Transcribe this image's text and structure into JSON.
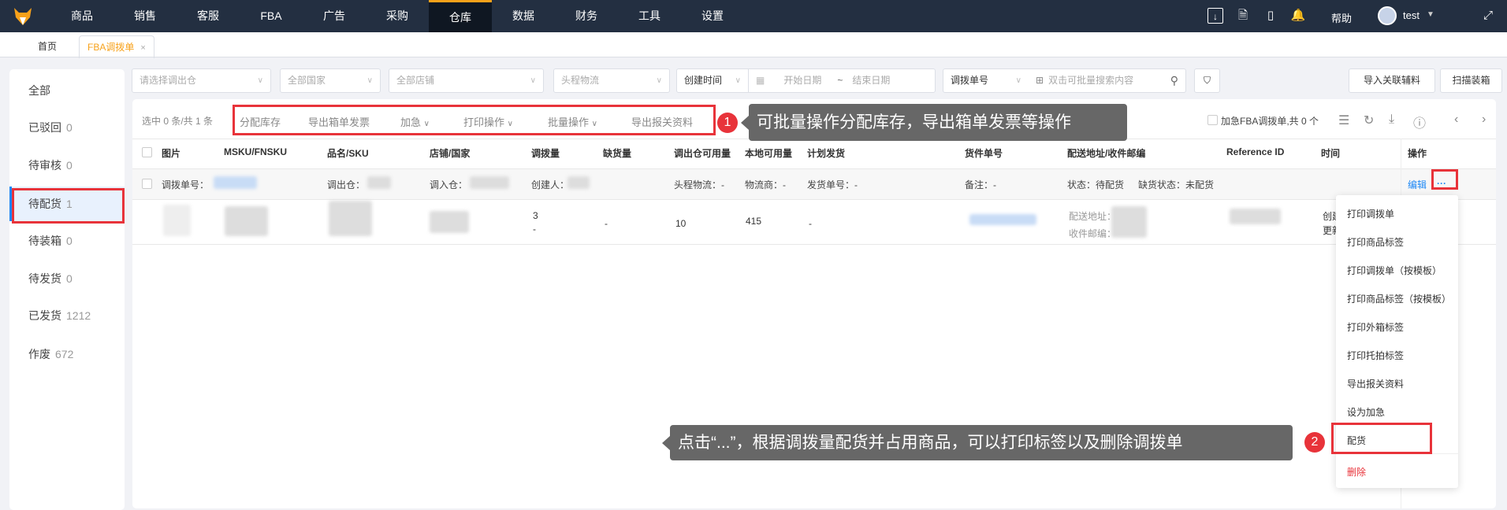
{
  "nav": {
    "items": [
      "商品",
      "销售",
      "客服",
      "FBA",
      "广告",
      "采购",
      "仓库",
      "数据",
      "财务",
      "工具",
      "设置"
    ],
    "active": "仓库",
    "help": "帮助",
    "user": "test"
  },
  "tabs": {
    "home": "首页",
    "current": "FBA调拨单",
    "close": "×"
  },
  "filters": {
    "warehouse_placeholder": "请选择调出仓",
    "country": "全部国家",
    "store": "全部店铺",
    "logistics": "头程物流",
    "time_type": "创建时间",
    "start_date": "开始日期",
    "tilde": "~",
    "end_date": "结束日期",
    "search_type": "调拨单号",
    "search_placeholder": "双击可批量搜索内容",
    "import_btn": "导入关联辅料",
    "scan_btn": "扫描装箱"
  },
  "sidebar": {
    "items": [
      {
        "label": "全部",
        "count": ""
      },
      {
        "label": "已驳回",
        "count": "0"
      },
      {
        "label": "待审核",
        "count": "0"
      },
      {
        "label": "待配货",
        "count": "1"
      },
      {
        "label": "待装箱",
        "count": "0"
      },
      {
        "label": "待发货",
        "count": "0"
      },
      {
        "label": "已发货",
        "count": "1212"
      },
      {
        "label": "作废",
        "count": "672"
      }
    ]
  },
  "toolbar": {
    "selected": "选中 0 条/共 1 条",
    "actions": [
      "分配库存",
      "导出箱单发票",
      "加急",
      "打印操作",
      "批量操作",
      "导出报关资料"
    ],
    "urgent": "加急FBA调拨单,共 0 个"
  },
  "table": {
    "headers": [
      "图片",
      "MSKU/FNSKU",
      "品名/SKU",
      "店铺/国家",
      "调拨量",
      "缺货量",
      "调出仓可用量",
      "本地可用量",
      "计划发货",
      "货件单号",
      "配送地址/收件邮编",
      "Reference ID",
      "时间",
      "操作"
    ],
    "group": {
      "order_no": "调拨单号：",
      "from": "调出仓：",
      "to": "调入仓：",
      "creator": "创建人：",
      "logistics": "头程物流：-",
      "carrier": "物流商：-",
      "ship_no": "发货单号：-",
      "remark": "备注：-",
      "status": "状态：待配货",
      "shortage": "缺货状态：未配货",
      "edit": "编辑",
      "more": "···"
    },
    "row": {
      "qty": "3",
      "qty2": "-",
      "shortage": "-",
      "out_avail": "10",
      "local_avail": "415",
      "plan": "-",
      "addr_label": "配送地址：",
      "zip_label": "收件邮编：",
      "time1": "创建",
      "time2": "更新"
    }
  },
  "menu": [
    "打印调拨单",
    "打印商品标签",
    "打印调拨单（按模板）",
    "打印商品标签（按模板）",
    "打印外箱标签",
    "打印托拍标签",
    "导出报关资料",
    "设为加急",
    "配货",
    "删除"
  ],
  "annotations": {
    "badge1": "1",
    "tip1": "可批量操作分配库存，导出箱单发票等操作",
    "badge2": "2",
    "tip2": "点击“...”，根据调拨量配货并占用商品，可以打印标签以及删除调拨单"
  }
}
